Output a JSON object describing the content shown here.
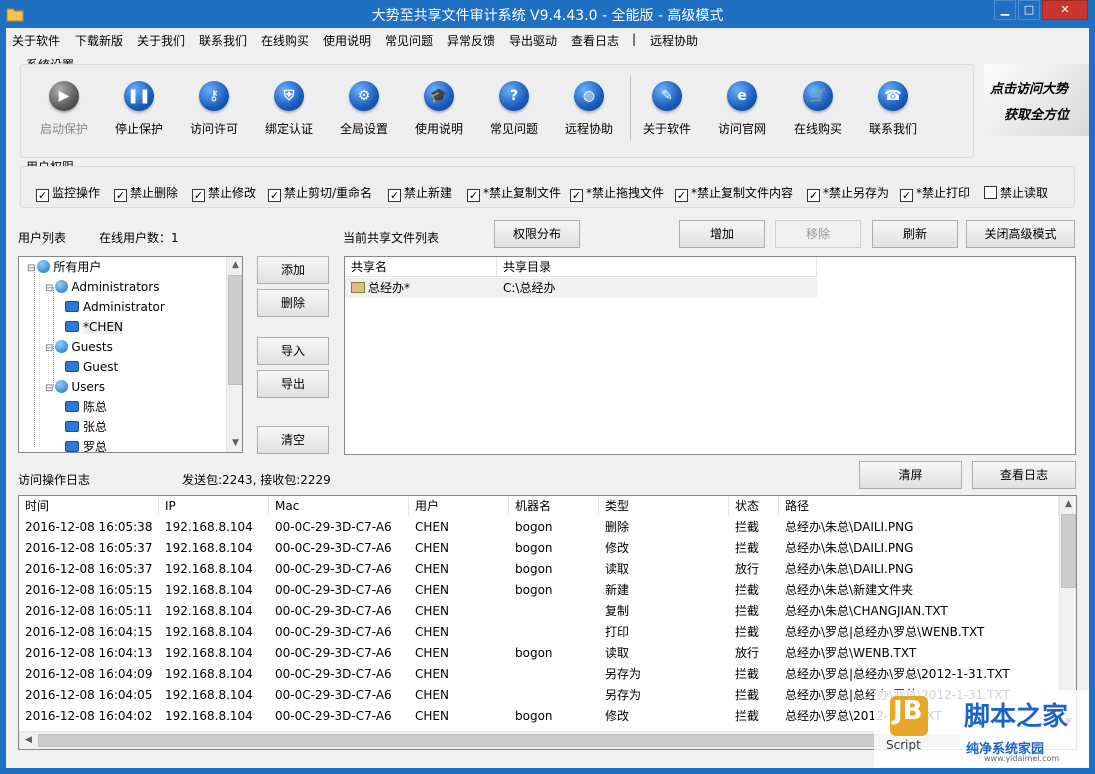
{
  "window": {
    "title": "大势至共享文件审计系统 V9.4.43.0 - 全能版 - 高级模式"
  },
  "menu": [
    "关于软件",
    "下载新版",
    "关于我们",
    "联系我们",
    "在线购买",
    "使用说明",
    "常见问题",
    "异常反馈",
    "导出驱动",
    "查看日志",
    "|",
    "远程协助"
  ],
  "system_settings": {
    "title": "系统设置",
    "buttons": [
      {
        "label": "启动保护",
        "icon": "play-icon",
        "disabled": true
      },
      {
        "label": "停止保护",
        "icon": "pause-icon"
      },
      {
        "label": "访问许可",
        "icon": "key-icon"
      },
      {
        "label": "绑定认证",
        "icon": "shield-icon"
      },
      {
        "label": "全局设置",
        "icon": "gear-icon"
      },
      {
        "label": "使用说明",
        "icon": "graduation-cap-icon"
      },
      {
        "label": "常见问题",
        "icon": "question-icon"
      },
      {
        "label": "远程协助",
        "icon": "globe-icon"
      },
      {
        "label": "关于软件",
        "icon": "edit-icon"
      },
      {
        "label": "访问官网",
        "icon": "ie-browser-icon"
      },
      {
        "label": "在线购买",
        "icon": "cart-icon"
      },
      {
        "label": "联系我们",
        "icon": "phone-icon"
      }
    ],
    "banner": [
      "点击访问大势",
      "获取全方位"
    ]
  },
  "permissions": {
    "title": "用户权限",
    "items": [
      {
        "label": "监控操作",
        "checked": true
      },
      {
        "label": "禁止删除",
        "checked": true
      },
      {
        "label": "禁止修改",
        "checked": true
      },
      {
        "label": "禁止剪切/重命名",
        "checked": true
      },
      {
        "label": "禁止新建",
        "checked": true
      },
      {
        "label": "*禁止复制文件",
        "checked": true
      },
      {
        "label": "*禁止拖拽文件",
        "checked": true
      },
      {
        "label": "*禁止复制文件内容",
        "checked": true
      },
      {
        "label": "*禁止另存为",
        "checked": true
      },
      {
        "label": "*禁止打印",
        "checked": true
      },
      {
        "label": "禁止读取",
        "checked": false
      }
    ]
  },
  "users": {
    "title": "用户列表",
    "online": "在线用户数：1",
    "tree": [
      {
        "label": "所有用户",
        "level": 0,
        "type": "group"
      },
      {
        "label": "Administrators",
        "level": 1,
        "type": "group"
      },
      {
        "label": "Administrator",
        "level": 2,
        "type": "user"
      },
      {
        "label": "*CHEN",
        "level": 2,
        "type": "user"
      },
      {
        "label": "Guests",
        "level": 1,
        "type": "group"
      },
      {
        "label": "Guest",
        "level": 2,
        "type": "user"
      },
      {
        "label": "Users",
        "level": 1,
        "type": "group"
      },
      {
        "label": "陈总",
        "level": 2,
        "type": "user"
      },
      {
        "label": "张总",
        "level": 2,
        "type": "user"
      },
      {
        "label": "罗总",
        "level": 2,
        "type": "user"
      }
    ],
    "buttons": {
      "add": "添加",
      "remove": "删除",
      "import": "导入",
      "export": "导出",
      "clear": "清空"
    }
  },
  "shares": {
    "title": "当前共享文件列表",
    "buttons": {
      "perm": "权限分布",
      "add": "增加",
      "remove": "移除",
      "refresh": "刷新",
      "close_adv": "关闭高级模式"
    },
    "columns": [
      "共享名",
      "共享目录"
    ],
    "rows": [
      [
        "总经办*",
        "C:\\总经办"
      ]
    ]
  },
  "log": {
    "title": "访问操作日志",
    "packets": "发送包:2243, 接收包:2229",
    "buttons": {
      "clear": "清屏",
      "view": "查看日志"
    },
    "columns": [
      "时间",
      "IP",
      "Mac",
      "用户",
      "机器名",
      "类型",
      "状态",
      "路径"
    ],
    "rows": [
      [
        "2016-12-08 16:05:38",
        "192.168.8.104",
        "00-0C-29-3D-C7-A6",
        "CHEN",
        "bogon",
        "删除",
        "拦截",
        "总经办\\朱总\\DAILI.PNG"
      ],
      [
        "2016-12-08 16:05:37",
        "192.168.8.104",
        "00-0C-29-3D-C7-A6",
        "CHEN",
        "bogon",
        "修改",
        "拦截",
        "总经办\\朱总\\DAILI.PNG"
      ],
      [
        "2016-12-08 16:05:37",
        "192.168.8.104",
        "00-0C-29-3D-C7-A6",
        "CHEN",
        "bogon",
        "读取",
        "放行",
        "总经办\\朱总\\DAILI.PNG"
      ],
      [
        "2016-12-08 16:05:15",
        "192.168.8.104",
        "00-0C-29-3D-C7-A6",
        "CHEN",
        "bogon",
        "新建",
        "拦截",
        "总经办\\朱总\\新建文件夹"
      ],
      [
        "2016-12-08 16:05:11",
        "192.168.8.104",
        "00-0C-29-3D-C7-A6",
        "CHEN",
        "",
        "复制",
        "拦截",
        "总经办\\朱总\\CHANGJIAN.TXT"
      ],
      [
        "2016-12-08 16:04:15",
        "192.168.8.104",
        "00-0C-29-3D-C7-A6",
        "CHEN",
        "",
        "打印",
        "拦截",
        "总经办\\罗总|总经办\\罗总\\WENB.TXT"
      ],
      [
        "2016-12-08 16:04:13",
        "192.168.8.104",
        "00-0C-29-3D-C7-A6",
        "CHEN",
        "bogon",
        "读取",
        "放行",
        "总经办\\罗总\\WENB.TXT"
      ],
      [
        "2016-12-08 16:04:09",
        "192.168.8.104",
        "00-0C-29-3D-C7-A6",
        "CHEN",
        "",
        "另存为",
        "拦截",
        "总经办\\罗总|总经办\\罗总\\2012-1-31.TXT"
      ],
      [
        "2016-12-08 16:04:05",
        "192.168.8.104",
        "00-0C-29-3D-C7-A6",
        "CHEN",
        "",
        "另存为",
        "拦截",
        "总经办\\罗总|总经办\\罗总\\2012-1-31.TXT"
      ],
      [
        "2016-12-08 16:04:02",
        "192.168.8.104",
        "00-0C-29-3D-C7-A6",
        "CHEN",
        "bogon",
        "修改",
        "拦截",
        "总经办\\罗总\\2012-1-31.TXT"
      ]
    ]
  },
  "watermark": {
    "site": "脚本之家",
    "sub": "纯净系统家园",
    "script": "Script",
    "url": "www.yidaimei.com"
  },
  "colors": {
    "titlebar": "#1f6fc2",
    "close": "#c7372f",
    "watermark_blue": "#1e63c8"
  }
}
